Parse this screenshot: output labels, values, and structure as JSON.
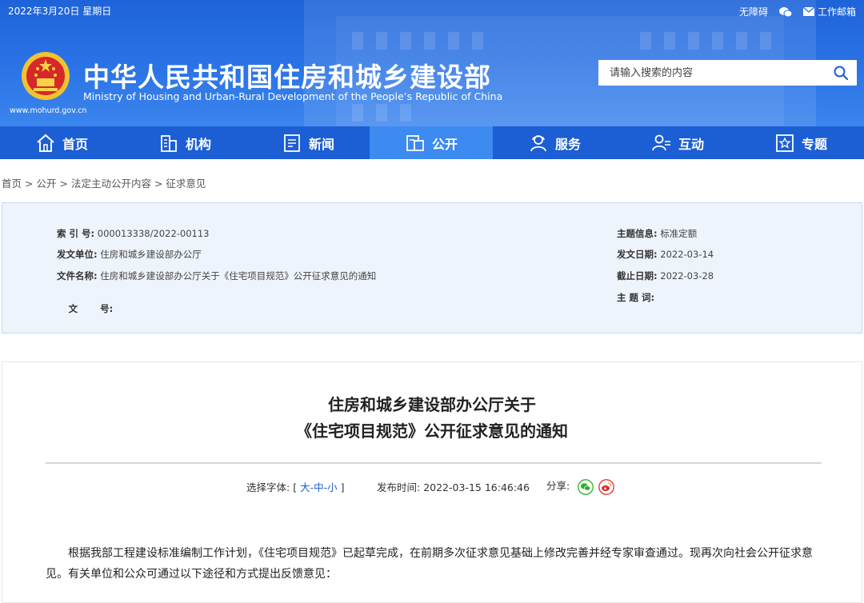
{
  "topbar": {
    "date": "2022年3月20日 星期日",
    "accessibility": "无障碍",
    "mail": "工作邮箱"
  },
  "header": {
    "title": "中华人民共和国住房和城乡建设部",
    "subtitle": "Ministry of Housing and Urban-Rural Development of the People’s Republic of China",
    "url": "www.mohurd.gov.cn",
    "search_placeholder": "请输入搜索的内容"
  },
  "nav": {
    "items": [
      {
        "label": "首页",
        "icon": "home-icon"
      },
      {
        "label": "机构",
        "icon": "building-icon"
      },
      {
        "label": "新闻",
        "icon": "news-icon"
      },
      {
        "label": "公开",
        "icon": "disclosure-icon"
      },
      {
        "label": "服务",
        "icon": "service-icon"
      },
      {
        "label": "互动",
        "icon": "interaction-icon"
      },
      {
        "label": "专题",
        "icon": "topic-icon"
      }
    ],
    "active": "公开"
  },
  "breadcrumb": {
    "items": [
      "首页",
      "公开",
      "法定主动公开内容",
      "征求意见"
    ],
    "sep": ">"
  },
  "info": {
    "index_label": "索 引 号:",
    "index_value": "000013338/2022-00113",
    "unit_label": "发文单位:",
    "unit_value": "住房和城乡建设部办公厅",
    "name_label": "文件名称:",
    "name_value": "住房和城乡建设部办公厅关于《住宅项目规范》公开征求意见的通知",
    "docno_label": "文       号:",
    "docno_value": "",
    "topic_label": "主题信息:",
    "topic_value": "标准定额",
    "date_label": "发文日期:",
    "date_value": "2022-03-14",
    "deadline_label": "截止日期:",
    "deadline_value": "2022-03-28",
    "keyword_label": "主 题 词:",
    "keyword_value": ""
  },
  "article": {
    "title_line1": "住房和城乡建设部办公厅关于",
    "title_line2": "《住宅项目规范》公开征求意见的通知",
    "font_label": "选择字体:",
    "font_open": "[",
    "font_large": "大",
    "font_medium": "中",
    "font_small": "小",
    "font_close": "]",
    "dash": "-",
    "publish_label": "发布时间:",
    "publish_time": "2022-03-15 16:46:46",
    "share_label": "分享:",
    "para_line1": "根据我部工程建设标准编制工作计划，《住宅项目规范》已起草完成，在前期多次征求意见基础上修改完善并经专家审查通过。现再次向社会公开征",
    "para_line2": "求意见。有关单位和公众可通过以下途径和方式提出反馈意见："
  },
  "colors": {
    "header_blue": "#2b74e6",
    "nav_blue": "#1c5ed4",
    "nav_active": "#3d8af0",
    "link_blue": "#1a5fd0",
    "info_bg": "#eef4fb",
    "wechat_green": "#2aae2a",
    "weibo_red": "#e0292f"
  }
}
